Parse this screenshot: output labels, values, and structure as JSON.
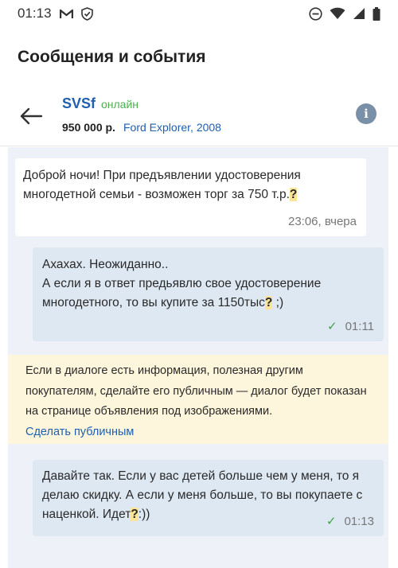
{
  "status_bar": {
    "time": "01:13",
    "icons": [
      "gmail-icon",
      "shield-icon",
      "do-not-disturb-icon",
      "wifi-icon",
      "signal-icon",
      "battery-icon"
    ]
  },
  "page": {
    "title": "Сообщения и события"
  },
  "chat_header": {
    "seller_name": "SVSf",
    "online_status": "онлайн",
    "price": "950 000 р.",
    "car": "Ford Explorer, 2008",
    "info_label": "i"
  },
  "messages": [
    {
      "direction": "incoming",
      "text_before": "Доброй ночи! При предъявлении удостоверения многодетной семьи - возможен торг за 750 т.р.",
      "highlight": "?",
      "text_after": "",
      "time": "23:06, вчера"
    },
    {
      "direction": "outgoing",
      "line1": "Ахахах. Неожиданно..",
      "text_before": "А если я в ответ предьявлю свое удостоверение многодетного, то вы купите за 1150тыс",
      "highlight": "?",
      "text_after": " ;)",
      "time": "01:11",
      "read": true
    },
    {
      "direction": "outgoing",
      "text_before": "Давайте так. Если у вас детей больше чем у меня, то я делаю скидку. А если у меня больше, то вы покупаете с наценкой. Идет",
      "highlight": "?",
      "text_after": ":))",
      "time": "01:13",
      "read": true
    }
  ],
  "notice": {
    "text": "Если в диалоге есть информация, полезная другим покупателям, сделайте его публичным — диалог будет показан на странице объявления под изображениями.",
    "link": "Сделать публичным"
  },
  "colors": {
    "accent_blue": "#1e5fb0",
    "online_green": "#4caf50",
    "outgoing_bubble": "#dde8f3",
    "chat_background": "#eef2f8",
    "notice_background": "#fdf6dc",
    "highlight_yellow": "#fbe59a"
  }
}
